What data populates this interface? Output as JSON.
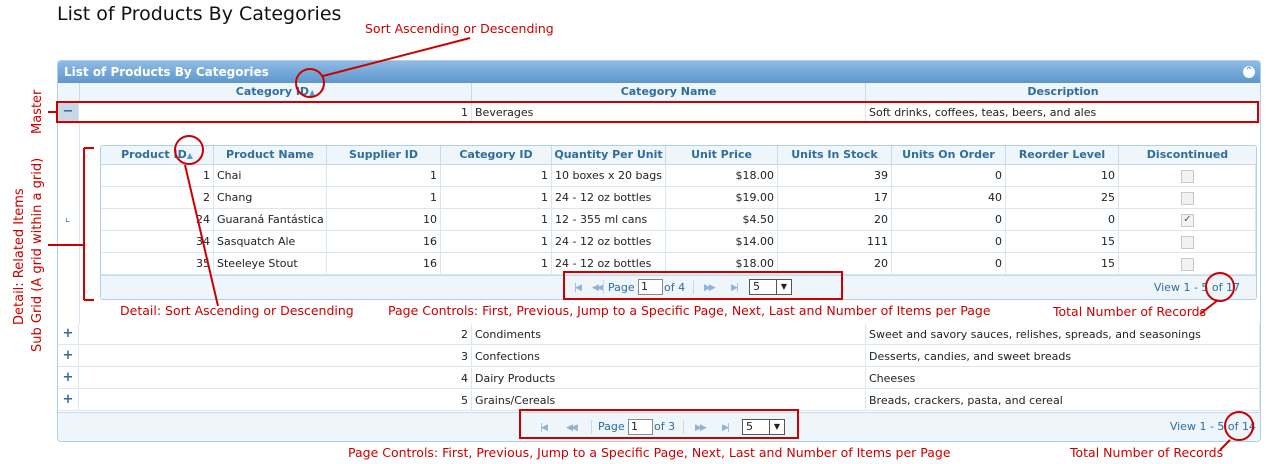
{
  "page_title": "List of Products By Categories",
  "grid": {
    "caption": "List of Products By Categories",
    "collapse_icon": "⌃",
    "columns": [
      "Category ID",
      "Category Name",
      "Description"
    ],
    "sort_icon": "sort-asc-desc-icon",
    "rows": [
      {
        "expander": "−",
        "id": "1",
        "name": "Beverages",
        "description": "Soft drinks, coffees, teas, beers, and ales"
      },
      {
        "expander": "+",
        "id": "2",
        "name": "Condiments",
        "description": "Sweet and savory sauces, relishes, spreads, and seasonings"
      },
      {
        "expander": "+",
        "id": "3",
        "name": "Confections",
        "description": "Desserts, candies, and sweet breads"
      },
      {
        "expander": "+",
        "id": "4",
        "name": "Dairy Products",
        "description": "Cheeses"
      },
      {
        "expander": "+",
        "id": "5",
        "name": "Grains/Cereals",
        "description": "Breads, crackers, pasta, and cereal"
      }
    ],
    "pager": {
      "page_label": "Page",
      "page_value": "1",
      "of_label": "of 3",
      "per_page": "5",
      "view_text": "View 1 - 5 of 14"
    }
  },
  "subgrid": {
    "expander_mark": "⌞",
    "columns": [
      "Product ID",
      "Product Name",
      "Supplier ID",
      "Category ID",
      "Quantity Per Unit",
      "Unit Price",
      "Units In Stock",
      "Units On Order",
      "Reorder Level",
      "Discontinued"
    ],
    "rows": [
      {
        "id": "1",
        "name": "Chai",
        "supplier": "1",
        "category": "1",
        "qty": "10 boxes x 20 bags",
        "price": "$18.00",
        "stock": "39",
        "order": "0",
        "reorder": "10",
        "discontinued": false
      },
      {
        "id": "2",
        "name": "Chang",
        "supplier": "1",
        "category": "1",
        "qty": "24 - 12 oz bottles",
        "price": "$19.00",
        "stock": "17",
        "order": "40",
        "reorder": "25",
        "discontinued": false
      },
      {
        "id": "24",
        "name": "Guaraná Fantástica",
        "supplier": "10",
        "category": "1",
        "qty": "12 - 355 ml cans",
        "price": "$4.50",
        "stock": "20",
        "order": "0",
        "reorder": "0",
        "discontinued": true
      },
      {
        "id": "34",
        "name": "Sasquatch Ale",
        "supplier": "16",
        "category": "1",
        "qty": "24 - 12 oz bottles",
        "price": "$14.00",
        "stock": "111",
        "order": "0",
        "reorder": "15",
        "discontinued": false
      },
      {
        "id": "35",
        "name": "Steeleye Stout",
        "supplier": "16",
        "category": "1",
        "qty": "24 - 12 oz bottles",
        "price": "$18.00",
        "stock": "20",
        "order": "0",
        "reorder": "15",
        "discontinued": false
      }
    ],
    "pager": {
      "page_label": "Page",
      "page_value": "1",
      "of_label": "of 4",
      "per_page": "5",
      "view_text": "View 1 - 5 of 17"
    }
  },
  "annotations": {
    "sort_top": "Sort Ascending or Descending",
    "master": "Master",
    "detail_vertical_1": "Detail: Related Items",
    "detail_vertical_2": "Sub Grid (A grid within a grid)",
    "detail_sort": "Detail: Sort Ascending or Descending",
    "page_controls": "Page Controls: First, Previous, Jump to a Specific Page, Next, Last and Number of Items per Page",
    "total_records": "Total Number of Records"
  },
  "colors": {
    "annotation": "#cc0000",
    "header_text": "#2e6e9e",
    "caption_bg": "#5e97cd"
  }
}
